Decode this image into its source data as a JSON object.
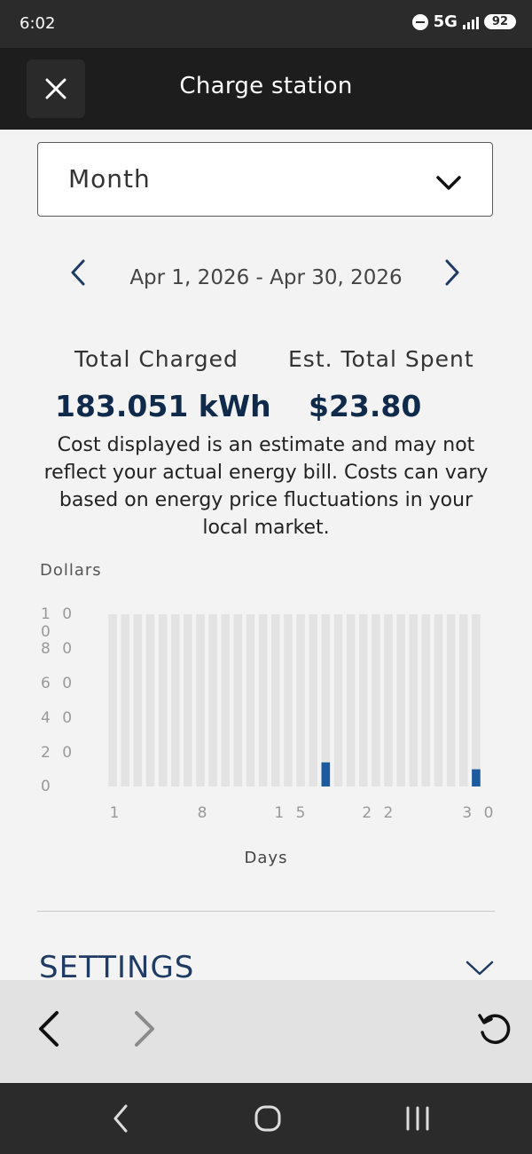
{
  "status_bar": {
    "time": "6:02",
    "network": "5G",
    "battery": "92"
  },
  "header": {
    "title": "Charge station"
  },
  "period_select": {
    "value": "Month"
  },
  "date_range": {
    "label": "Apr 1, 2026 - Apr 30, 2026"
  },
  "stats": {
    "total_charged_label": "Total Charged",
    "total_charged_value": "183.051 kWh",
    "total_spent_label": "Est. Total Spent",
    "total_spent_value": "$23.80"
  },
  "disclaimer": "Cost displayed is an estimate and may not reflect your actual energy bill. Costs can vary based on energy price fluctuations in your local market.",
  "chart_data": {
    "type": "bar",
    "ylabel": "Dollars",
    "xlabel": "Days",
    "ylim": [
      0,
      100
    ],
    "yticks": [
      "1 0 0",
      "8 0",
      "6 0",
      "4 0",
      "2 0",
      "0"
    ],
    "xticks": [
      {
        "day": 1,
        "label": "1"
      },
      {
        "day": 8,
        "label": "8"
      },
      {
        "day": 15,
        "label": "1 5"
      },
      {
        "day": 22,
        "label": "2 2"
      },
      {
        "day": 30,
        "label": "3 0"
      }
    ],
    "categories": [
      1,
      2,
      3,
      4,
      5,
      6,
      7,
      8,
      9,
      10,
      11,
      12,
      13,
      14,
      15,
      16,
      17,
      18,
      19,
      20,
      21,
      22,
      23,
      24,
      25,
      26,
      27,
      28,
      29,
      30
    ],
    "values": [
      0,
      0,
      0,
      0,
      0,
      0,
      0,
      0,
      0,
      0,
      0,
      0,
      0,
      0,
      0,
      0,
      0,
      14,
      0,
      0,
      0,
      0,
      0,
      0,
      0,
      0,
      0,
      0,
      0,
      10
    ],
    "bar_color": "#1c5aa0",
    "track_color": "#e3e3e3"
  },
  "settings": {
    "label": "SETTINGS"
  }
}
